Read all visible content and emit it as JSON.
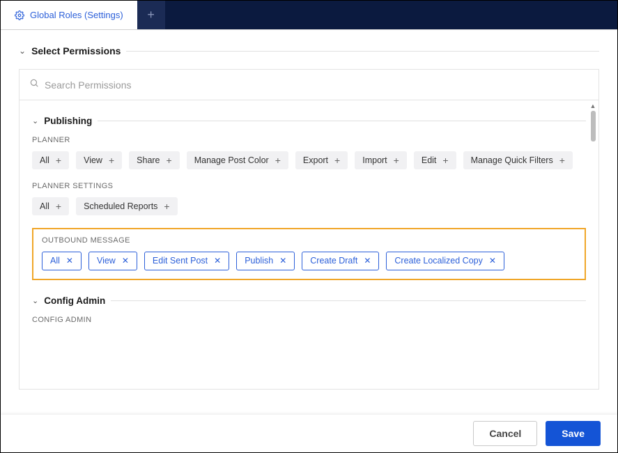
{
  "tab": {
    "label": "Global Roles (Settings)"
  },
  "section": {
    "title": "Select Permissions"
  },
  "search": {
    "placeholder": "Search Permissions"
  },
  "publishing": {
    "title": "Publishing",
    "planner": {
      "label": "PLANNER",
      "chips": [
        "All",
        "View",
        "Share",
        "Manage Post Color",
        "Export",
        "Import",
        "Edit",
        "Manage Quick Filters"
      ]
    },
    "plannerSettings": {
      "label": "PLANNER SETTINGS",
      "chips": [
        "All",
        "Scheduled Reports"
      ]
    },
    "outbound": {
      "label": "OUTBOUND MESSAGE",
      "chips": [
        "All",
        "View",
        "Edit Sent Post",
        "Publish",
        "Create Draft",
        "Create Localized Copy"
      ]
    }
  },
  "configAdmin": {
    "title": "Config Admin",
    "group": {
      "label": "CONFIG ADMIN"
    }
  },
  "footer": {
    "cancel": "Cancel",
    "save": "Save"
  }
}
